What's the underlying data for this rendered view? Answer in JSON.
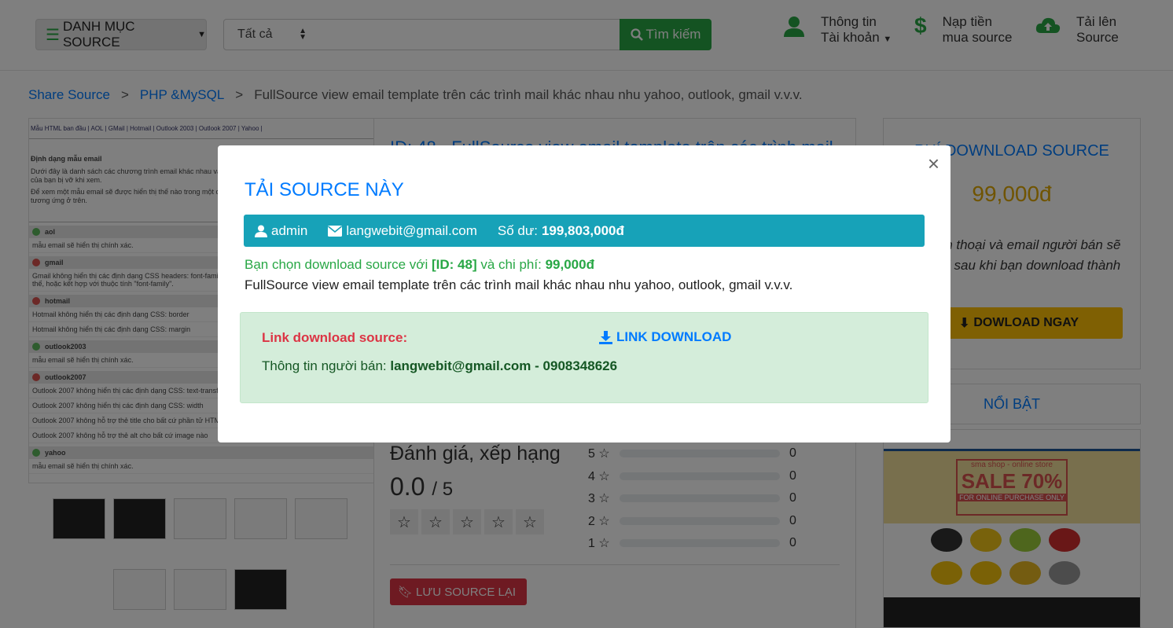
{
  "header": {
    "category_label": "DANH MỤC SOURCE",
    "search_select": "Tất cả",
    "search_placeholder": "",
    "search_button": "Tìm kiếm",
    "nav": {
      "account_line1": "Thông tin",
      "account_line2": "Tài khoản",
      "topup_line1": "Nạp tiền",
      "topup_line2": "mua source",
      "upload_line1": "Tải lên",
      "upload_line2": "Source"
    }
  },
  "breadcrumb": {
    "items": [
      "Share Source",
      "PHP &MySQL"
    ],
    "current": "FullSource view email template trên các trình mail khác nhau nhu yahoo, outlook, gmail v.v.v.",
    "separator": ">"
  },
  "preview": {
    "tabs": "Mẫu HTML ban đầu |  AOL |  GMail |  Hotmail |  Outlook 2003 |  Outlook 2007 |  Yahoo |",
    "heading": "Định dạng mẫu email",
    "para1": "Dưới đây là danh sách các chương trình email khác nhau và các định dạng khác nhau mà có thể mẫu email của bạn bị vỡ khi xem.",
    "para2": "Để xem một mẫu email sẽ được hiển thị thế nào trong một chương trình email cụ thể, nhấp vào liên kết tương ứng ở trên.",
    "sections": [
      {
        "name": "aol",
        "status": "ok",
        "lines": [
          "mẫu email sẽ hiển thị chính xác."
        ]
      },
      {
        "name": "gmail",
        "status": "bad",
        "lines": [
          "Gmail không hiển thị các định dạng CSS headers: font-family. Bạn có thể dùng thẻ HTML \"font face\" thay thế, hoặc kết hợp với thuộc tính \"font-family\"."
        ]
      },
      {
        "name": "hotmail",
        "status": "bad",
        "lines": [
          "Hotmail không hiển thị các định dạng CSS: border",
          "Hotmail không hiển thị các định dạng CSS: margin"
        ]
      },
      {
        "name": "outlook2003",
        "status": "ok",
        "lines": [
          "mẫu email sẽ hiển thị chính xác."
        ]
      },
      {
        "name": "outlook2007",
        "status": "bad",
        "lines": [
          "Outlook 2007 không hiển thị các định dạng CSS: text-transform",
          "Outlook 2007 không hiển thị các định dạng CSS: width",
          "Outlook 2007 không hỗ trợ thẻ title cho bất cứ phần tử HTML nào",
          "Outlook 2007 không hỗ trợ thẻ alt cho bất cứ image nào"
        ]
      },
      {
        "name": "yahoo",
        "status": "ok",
        "lines": [
          "mẫu email sẽ hiển thị chính xác."
        ]
      }
    ]
  },
  "detail": {
    "title": "ID: 48 - FullSource view email template trên các trình mail",
    "rating_title": "Đánh giá, xếp hạng",
    "rating_score": "0.0",
    "rating_max": "/ 5",
    "bars": [
      {
        "label": "5",
        "count": "0"
      },
      {
        "label": "4",
        "count": "0"
      },
      {
        "label": "3",
        "count": "0"
      },
      {
        "label": "2",
        "count": "0"
      },
      {
        "label": "1",
        "count": "0"
      }
    ],
    "save_button": "LƯU SOURCE LẠI"
  },
  "sidebar": {
    "title": "PHÍ DOWNLOAD SOURCE",
    "price": "99,000đ",
    "note": "Số điện thoại và email người bán sẽ hiển thị sau khi bạn download thành công",
    "download_button": "DOWLOAD NGAY",
    "featured": "NỔI BẬT",
    "ad": {
      "line1": "sma shop - online store",
      "sale": "SALE 70%",
      "line3": "FOR ONLINE PURCHASE ONLY"
    }
  },
  "modal": {
    "close": "×",
    "title": "TẢI SOURCE NÀY",
    "user": "admin",
    "email": "langwebit@gmail.com",
    "balance_label": "Số dư:",
    "balance_value": "199,803,000đ",
    "choice_prefix": "Bạn chọn download source với",
    "choice_id": "[ID: 48]",
    "choice_mid": "và chi phí:",
    "choice_cost": "99,000đ",
    "source_name": "FullSource view email template trên các trình mail khác nhau nhu yahoo, outlook, gmail v.v.v.",
    "link_label": "Link download source:",
    "link_button": "LINK DOWNLOAD",
    "seller_label": "Thông tin người bán:",
    "seller_value": "langwebit@gmail.com - 0908348626"
  },
  "colors": {
    "primary": "#007bff",
    "success": "#28a745",
    "info": "#17a2b8",
    "danger": "#dc3545",
    "warning": "#ffc107"
  }
}
